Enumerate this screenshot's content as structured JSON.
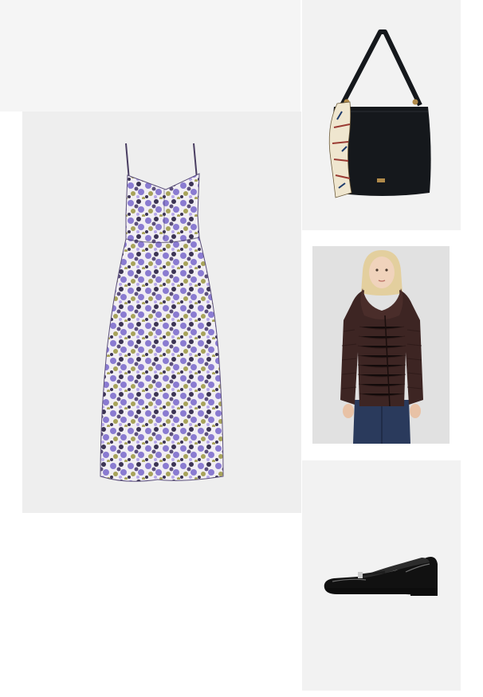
{
  "products": [
    {
      "id": "dress",
      "name_icon": "floral-slip-dress-image",
      "background": "#eeeeee",
      "print_colors": [
        "#8a7bd1",
        "#3c3454",
        "#a7a35a",
        "#f1eef3",
        "#5b4f7b"
      ]
    },
    {
      "id": "bag",
      "name_icon": "black-tote-bag-image",
      "background": "#f2f2f2",
      "color": "#15181c"
    },
    {
      "id": "jacket",
      "name_icon": "brown-puffer-jacket-image",
      "background": "#e1e1e1",
      "color": "#3d2523"
    },
    {
      "id": "shoe",
      "name_icon": "black-patent-flat-shoe-image",
      "background": "#f2f2f2",
      "color": "#0d0d0d"
    }
  ],
  "empty_tile_background": "#f5f5f5"
}
